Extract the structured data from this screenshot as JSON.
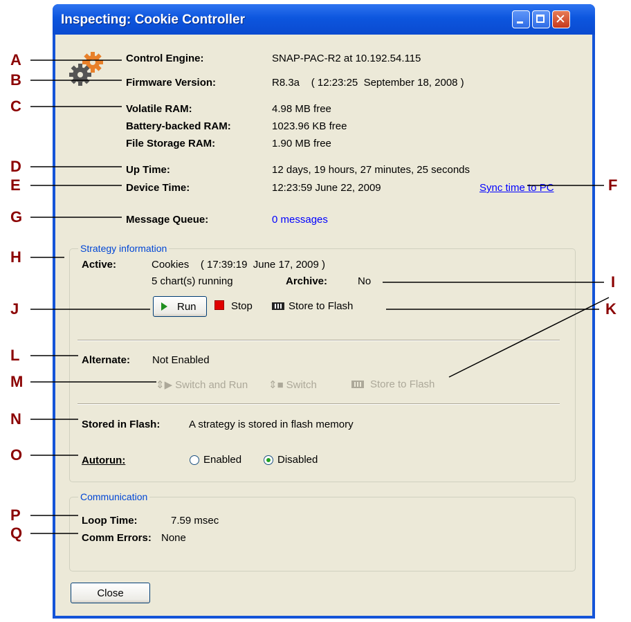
{
  "window": {
    "title": "Inspecting:  Cookie Controller"
  },
  "info": {
    "control_engine": {
      "label": "Control Engine:",
      "value": "SNAP-PAC-R2 at 10.192.54.115"
    },
    "firmware": {
      "label": "Firmware Version:",
      "value": "R8.3a    ( 12:23:25  September 18, 2008 )"
    },
    "volatile_ram": {
      "label": "Volatile RAM:",
      "value": "4.98 MB free"
    },
    "battery_ram": {
      "label": "Battery-backed RAM:",
      "value": "1023.96 KB free"
    },
    "file_ram": {
      "label": "File Storage RAM:",
      "value": "1.90 MB free"
    },
    "up_time": {
      "label": "Up Time:",
      "value": "12 days, 19 hours, 27 minutes, 25 seconds"
    },
    "device_time": {
      "label": "Device Time:",
      "value": "12:23:59  June 22, 2009",
      "link": "Sync time to PC"
    },
    "message_queue": {
      "label": "Message Queue:",
      "link": "0 messages"
    }
  },
  "strategy": {
    "group_title": "Strategy information",
    "active_label": "Active:",
    "active_value": "Cookies    ( 17:39:19  June 17, 2009 )",
    "charts": "5 chart(s) running",
    "archive_label": "Archive:",
    "archive_value": "No",
    "run_label": "Run",
    "stop_label": "Stop",
    "store_label": "Store to Flash",
    "alternate_label": "Alternate:",
    "alternate_value": "Not Enabled",
    "switch_run_label": "Switch and Run",
    "switch_label": "Switch",
    "alt_store_label": "Store to Flash",
    "stored_label": "Stored in Flash:",
    "stored_value": "A strategy is stored in flash memory",
    "autorun_label": "Autorun:",
    "enabled_label": "Enabled",
    "disabled_label": "Disabled",
    "autorun_selected": "Disabled"
  },
  "communication": {
    "group_title": "Communication",
    "loop_label": "Loop Time:",
    "loop_value": "7.59 msec",
    "errors_label": "Comm Errors:",
    "errors_value": "None"
  },
  "close_label": "Close",
  "callouts": [
    "A",
    "B",
    "C",
    "D",
    "E",
    "F",
    "G",
    "H",
    "I",
    "J",
    "K",
    "L",
    "M",
    "N",
    "O",
    "P",
    "Q"
  ],
  "colors": {
    "callout": "#8b0000",
    "link": "#0000ff",
    "group_title": "#0046d5",
    "titlebar": "#0a4ad0"
  }
}
